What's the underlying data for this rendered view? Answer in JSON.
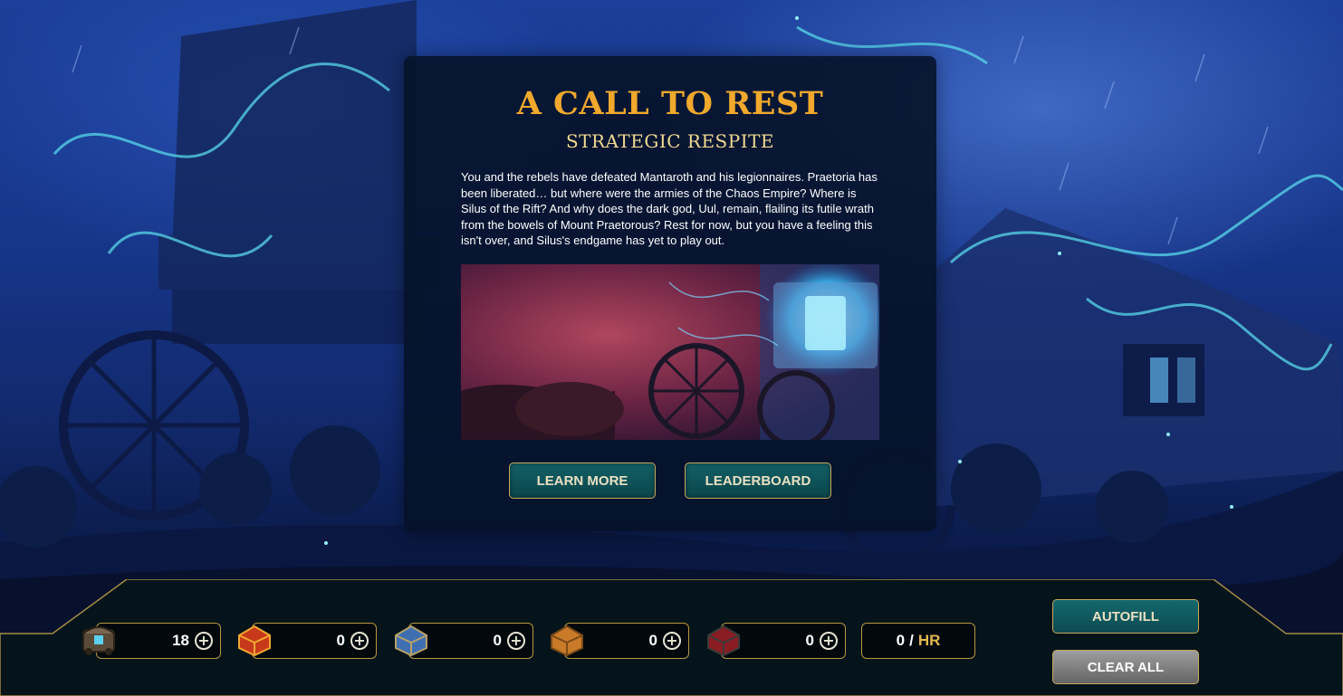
{
  "event": {
    "title": "A CALL TO REST",
    "subtitle": "STRATEGIC RESPITE",
    "description": "You and the rebels have defeated Mantaroth and his legionnaires. Praetoria has been liberated… but where were the armies of the Chaos Empire? Where is Silus of the Rift? And why does the dark god, Uul, remain, flailing its futile wrath from the bowels of Mount Praetorous? Rest for now, but you have a feeling this isn't over, and Silus's endgame has yet to play out.",
    "learn_more_label": "LEARN MORE",
    "leaderboard_label": "LEADERBOARD"
  },
  "chests": [
    {
      "name": "caravan-chest",
      "count": "18",
      "icon": "caravan-chest-icon"
    },
    {
      "name": "red-chest",
      "count": "0",
      "icon": "red-chest-icon"
    },
    {
      "name": "blue-chest",
      "count": "0",
      "icon": "blue-chest-icon"
    },
    {
      "name": "orange-chest",
      "count": "0",
      "icon": "orange-chest-icon"
    },
    {
      "name": "crimson-chest",
      "count": "0",
      "icon": "crimson-chest-icon"
    }
  ],
  "rate": {
    "value": "0",
    "separator": "/",
    "unit": "HR"
  },
  "controls": {
    "autofill_label": "AUTOFILL",
    "clear_all_label": "CLEAR ALL"
  },
  "colors": {
    "title": "#f0a82d",
    "subtitle": "#f1d991",
    "gold_border": "#b9963f",
    "teal_button": "#126066"
  }
}
